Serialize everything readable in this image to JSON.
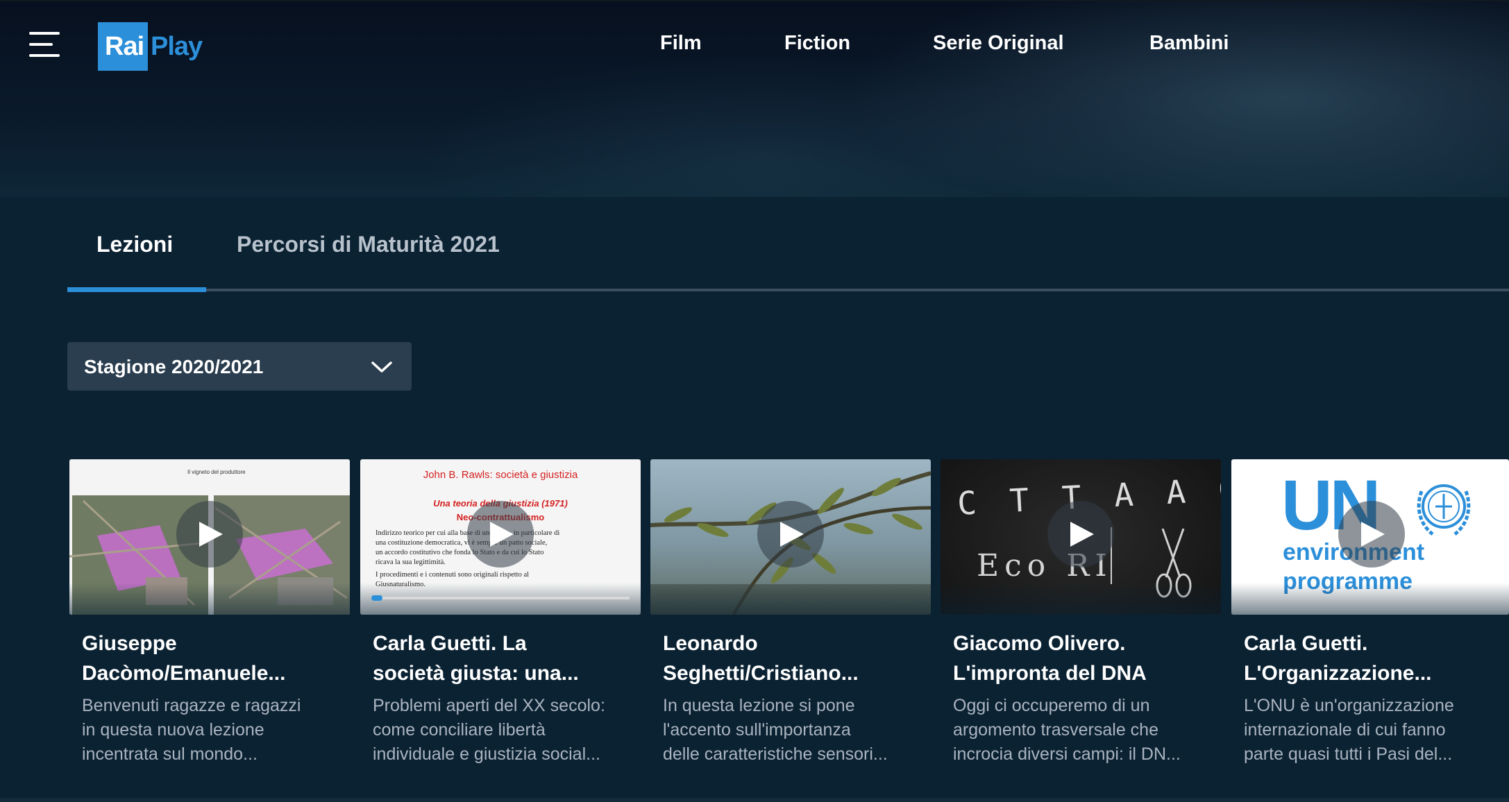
{
  "header": {
    "logo": {
      "rai": "Rai",
      "play": "Play"
    },
    "nav": [
      "Film",
      "Fiction",
      "Serie Original",
      "Bambini"
    ]
  },
  "tabs": [
    {
      "label": "Lezioni",
      "active": true
    },
    {
      "label": "Percorsi di Maturità 2021",
      "active": false
    }
  ],
  "season_select": {
    "value": "Stagione 2020/2021"
  },
  "colors": {
    "accent": "#2c8fd9",
    "background": "#0b2233",
    "header": "#07101f"
  },
  "cards": [
    {
      "title": "Giuseppe\nDacòmo/Emanuele...",
      "description": "Benvenuti ragazze e ragazzi\nin questa nuova lezione\nincentrata sul mondo...",
      "thumb_caption": "Il vigneto del produttore"
    },
    {
      "title": "Carla Guetti. La\nsocietà giusta: una...",
      "description": "Problemi aperti del XX secolo:\ncome conciliare libertà\nindividuale e giustizia social...",
      "slide": {
        "heading": "John B. Rawls: società e giustizia",
        "subtitle": "Una teoria della giustizia (1971)",
        "subtitle2": "Neo-contrattualismo",
        "line1": "Indirizzo teorico per cui alla base di uno Stato, in particolare di",
        "line2": "una costituzione democratica, vi è sempre un patto sociale,",
        "line3": "un accordo costitutivo che fonda lo Stato e da cui lo Stato",
        "line4": "ricava la sua legittimità.",
        "line5": "I procedimenti e i contenuti sono originali rispetto al",
        "line6": "Giusnaturalismo."
      }
    },
    {
      "title": "Leonardo\nSeghetti/Cristiano...",
      "description": "In questa lezione si pone\nl'accento sull'importanza\ndelle caratteristiche sensori..."
    },
    {
      "title": "Giacomo Olivero.\nL'impronta del DNA",
      "description": "Oggi ci occuperemo di un\nargomento trasversale che\nincrocia diversi campi: il DN...",
      "chalk": {
        "line1": "C T T A A G",
        "line2": "Eco RI"
      }
    },
    {
      "title": "Carla Guetti.\nL'Organizzazione...",
      "description": "L'ONU è un'organizzazione\ninternazionale di cui fanno\nparte quasi tutti i Pasi del...",
      "unep": {
        "un": "UN",
        "line1": "environment",
        "line2": "programme"
      }
    }
  ]
}
